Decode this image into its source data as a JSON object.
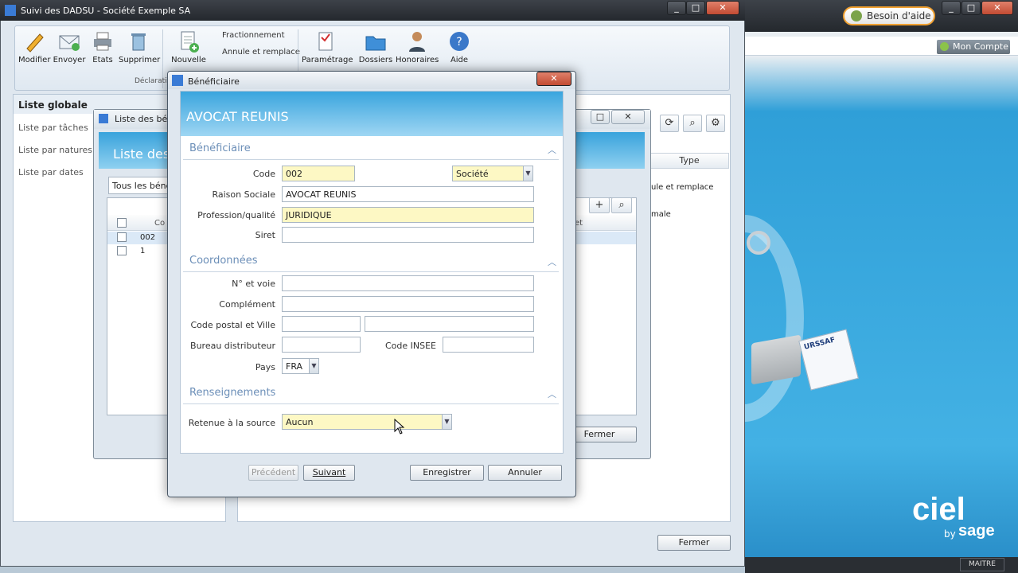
{
  "main_window": {
    "title": "Suivi des DADSU - Société Exemple SA",
    "ribbon": {
      "buttons": [
        {
          "label": "Modifier"
        },
        {
          "label": "Envoyer"
        },
        {
          "label": "Etats"
        },
        {
          "label": "Supprimer"
        },
        {
          "label": "Nouvelle"
        },
        {
          "label": "Paramétrage"
        },
        {
          "label": "Dossiers"
        },
        {
          "label": "Honoraires"
        },
        {
          "label": "Aide"
        }
      ],
      "links": [
        "Fractionnement",
        "Annule et remplace"
      ],
      "group_label": "Déclarati"
    },
    "sidebar": {
      "items": [
        "Liste globale",
        "Liste par tâches",
        "Liste par natures",
        "Liste par dates"
      ]
    },
    "right_table": {
      "header_type": "Type",
      "rows": [
        "ule et remplace",
        "male"
      ]
    },
    "close_label": "Fermer"
  },
  "outer_app": {
    "help_button": "Besoin d'aide",
    "account_button": "Mon Compte",
    "status_user": "MAITRE",
    "urssaf_label": "URSSAF",
    "logo_text": "ciel",
    "logo_by": "by",
    "logo_sage": "sage"
  },
  "list_window": {
    "title": "Liste des béné",
    "header": "Liste des",
    "filter": "Tous les béné",
    "col_code": "Co",
    "col_right": "et",
    "rows": [
      "002",
      "1"
    ],
    "close_label": "Fermer"
  },
  "dialog": {
    "title": "Bénéficiaire",
    "banner": "AVOCAT REUNIS",
    "sections": {
      "beneficiaire": "Bénéficiaire",
      "coordonnees": "Coordonnées",
      "renseignements": "Renseignements"
    },
    "labels": {
      "code": "Code",
      "raison_sociale": "Raison Sociale",
      "profession": "Profession/qualité",
      "siret": "Siret",
      "voie": "N° et voie",
      "complement": "Complément",
      "cp_ville": "Code postal et Ville",
      "bureau": "Bureau distributeur",
      "insee": "Code INSEE",
      "pays": "Pays",
      "retenue": "Retenue à la source"
    },
    "values": {
      "code": "002",
      "type": "Société",
      "raison_sociale": "AVOCAT REUNIS",
      "profession": "JURIDIQUE",
      "siret": "",
      "voie": "",
      "complement": "",
      "cp": "",
      "ville": "",
      "bureau": "",
      "insee": "",
      "pays": "FRA",
      "retenue": "Aucun"
    },
    "buttons": {
      "precedent": "Précédent",
      "suivant": "Suivant",
      "enregistrer": "Enregistrer",
      "annuler": "Annuler"
    }
  }
}
